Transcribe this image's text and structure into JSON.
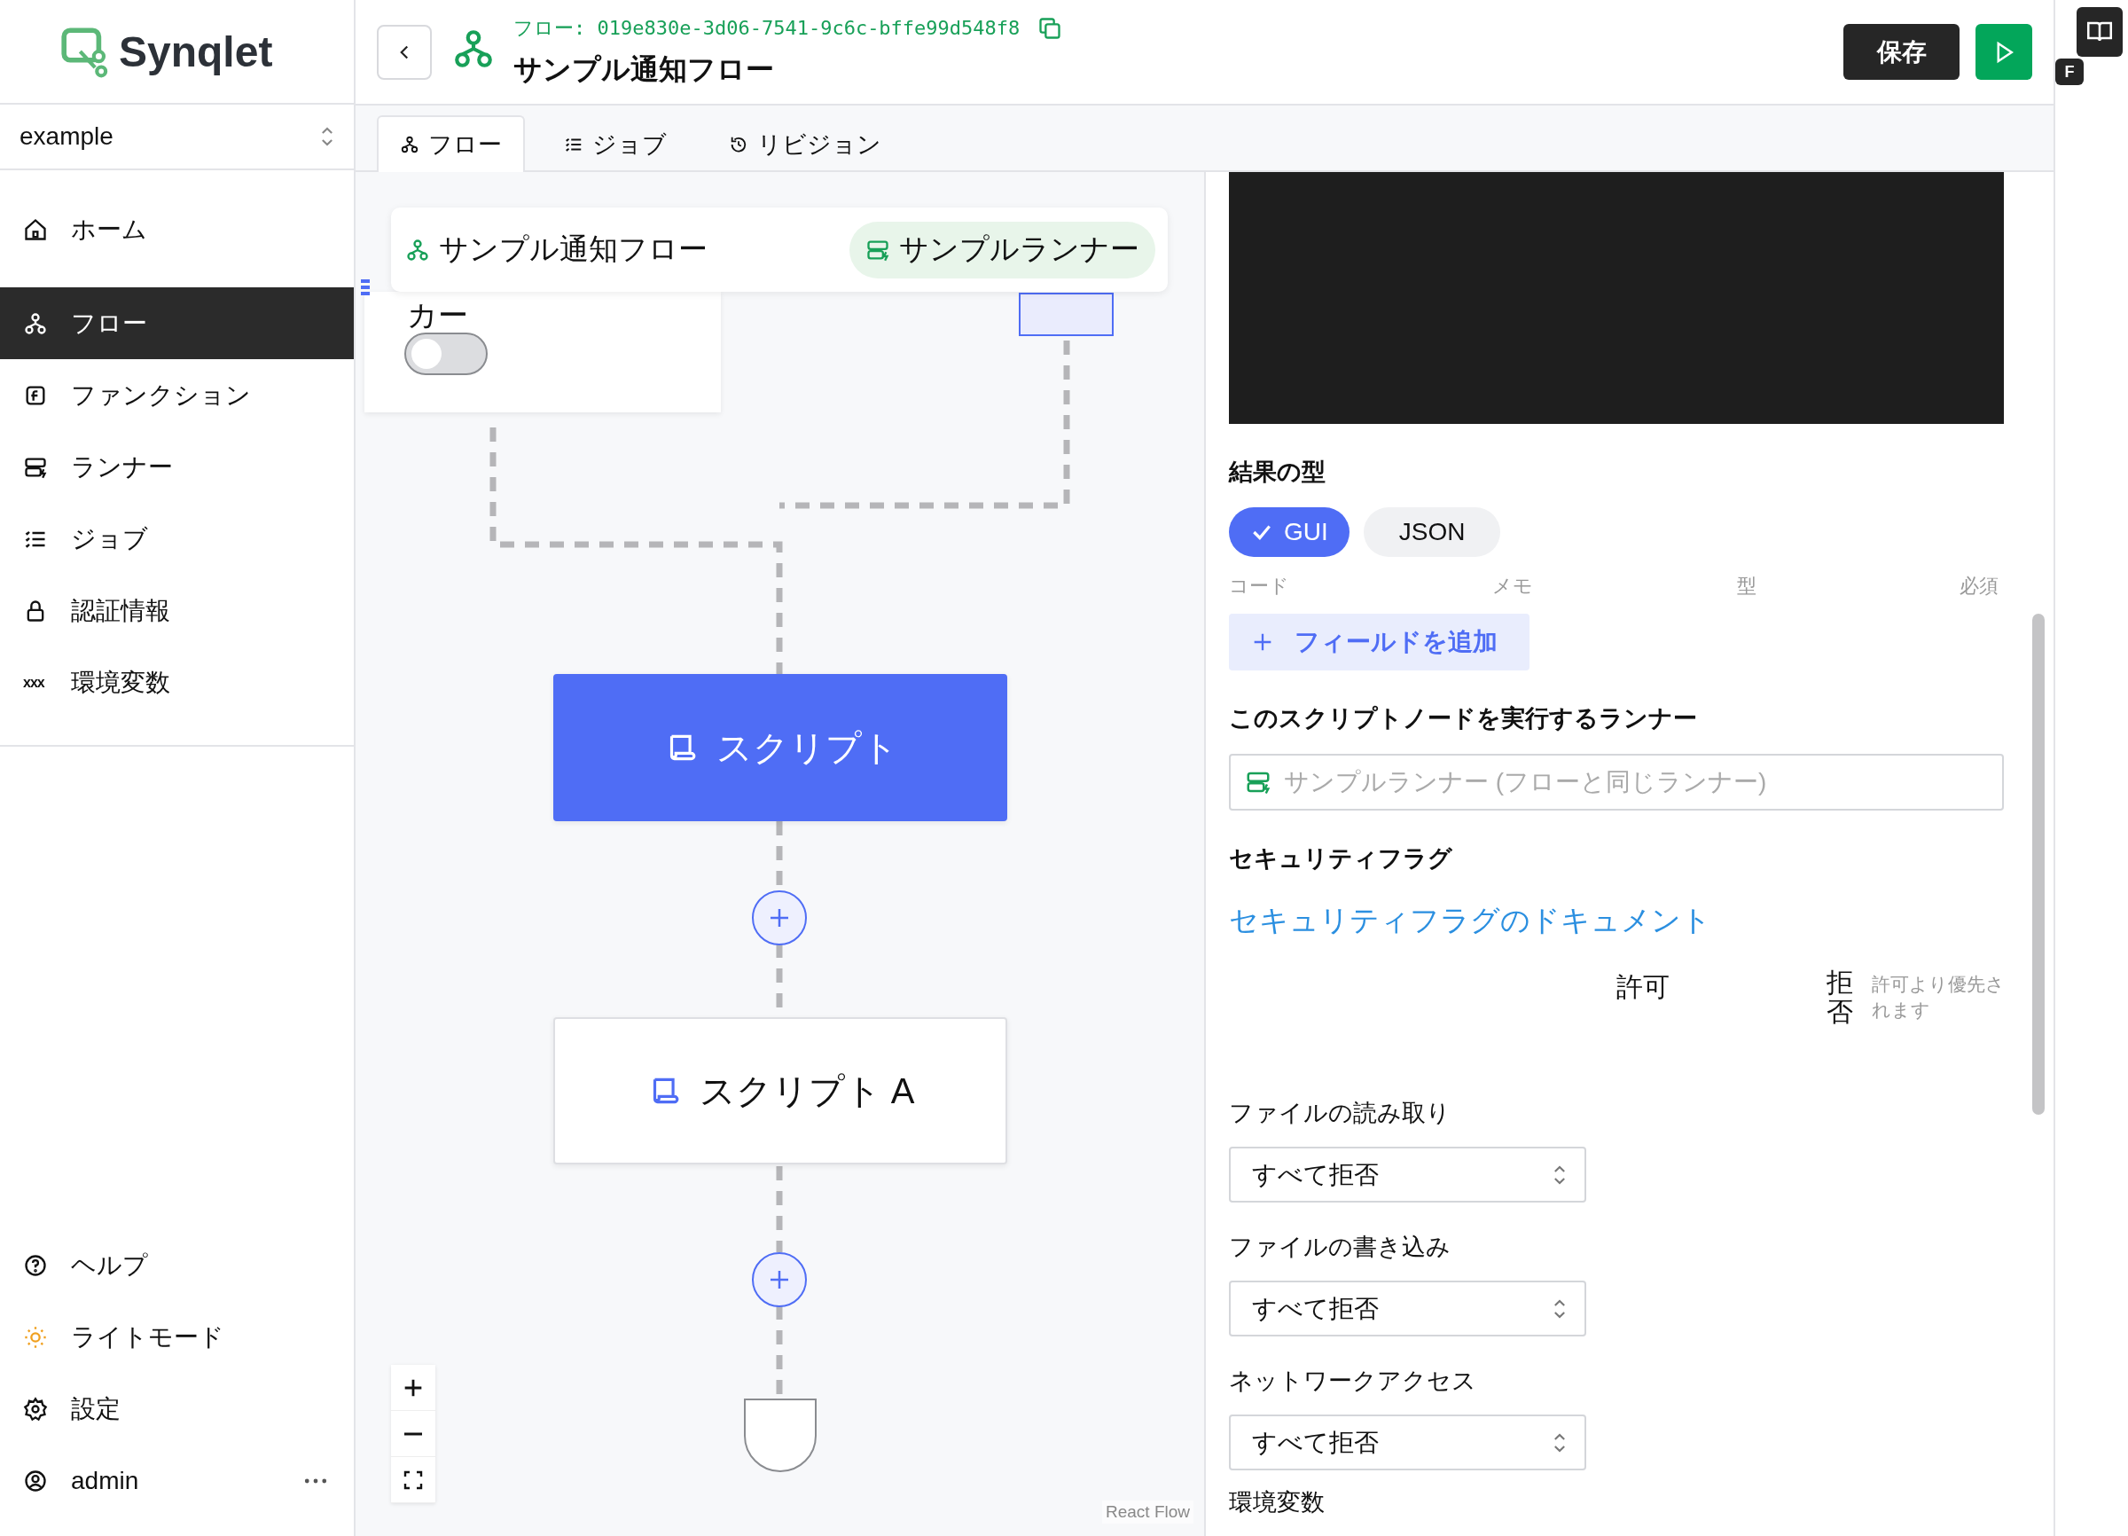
{
  "sidebar": {
    "logo": "Synqlet",
    "workspace": "example",
    "nav": [
      {
        "label": "ホーム",
        "selected": false
      },
      {
        "label": "フロー",
        "selected": true
      },
      {
        "label": "ファンクション",
        "selected": false
      },
      {
        "label": "ランナー",
        "selected": false
      },
      {
        "label": "ジョブ",
        "selected": false
      },
      {
        "label": "認証情報",
        "selected": false
      },
      {
        "label": "環境変数",
        "selected": false,
        "icon_text": "xxx"
      }
    ],
    "footer": [
      {
        "label": "ヘルプ"
      },
      {
        "label": "ライトモード"
      },
      {
        "label": "設定"
      }
    ],
    "user": "admin"
  },
  "header": {
    "flow_id": "フロー: 019e830e-3d06-7541-9c6c-bffe99d548f8",
    "title": "サンプル通知フロー",
    "save": "保存"
  },
  "side_strip": {
    "badge": "F"
  },
  "tabs": [
    {
      "label": "フロー",
      "selected": true
    },
    {
      "label": "ジョブ",
      "selected": false
    },
    {
      "label": "リビジョン",
      "selected": false
    }
  ],
  "canvas": {
    "partial_node": {
      "label": "カー",
      "on": false
    },
    "flow_bar": {
      "name": "サンプル通知フロー",
      "runner": "サンプルランナー"
    },
    "nodes": [
      {
        "label": "スクリプト",
        "selected": true
      },
      {
        "label": "スクリプト A",
        "selected": false
      }
    ],
    "attribution": "React Flow"
  },
  "panel": {
    "result_type": {
      "label": "結果の型",
      "options": [
        {
          "label": "GUI",
          "selected": true
        },
        {
          "label": "JSON",
          "selected": false
        }
      ]
    },
    "columns": [
      "コード",
      "メモ",
      "型",
      "必須"
    ],
    "add_field": "フィールドを追加",
    "runner": {
      "label": "このスクリプトノードを実行するランナー",
      "placeholder": "サンプルランナー (フローと同じランナー)"
    },
    "security": {
      "label": "セキュリティフラグ",
      "doc_link": "セキュリティフラグのドキュメント",
      "allow": "許可",
      "deny": "拒否",
      "deny_note": "許可より優先されます",
      "flags": [
        {
          "label": "ファイルの読み取り",
          "value": "すべて拒否"
        },
        {
          "label": "ファイルの書き込み",
          "value": "すべて拒否"
        },
        {
          "label": "ネットワークアクセス",
          "value": "すべて拒否"
        }
      ]
    },
    "env_label": "環境変数"
  }
}
